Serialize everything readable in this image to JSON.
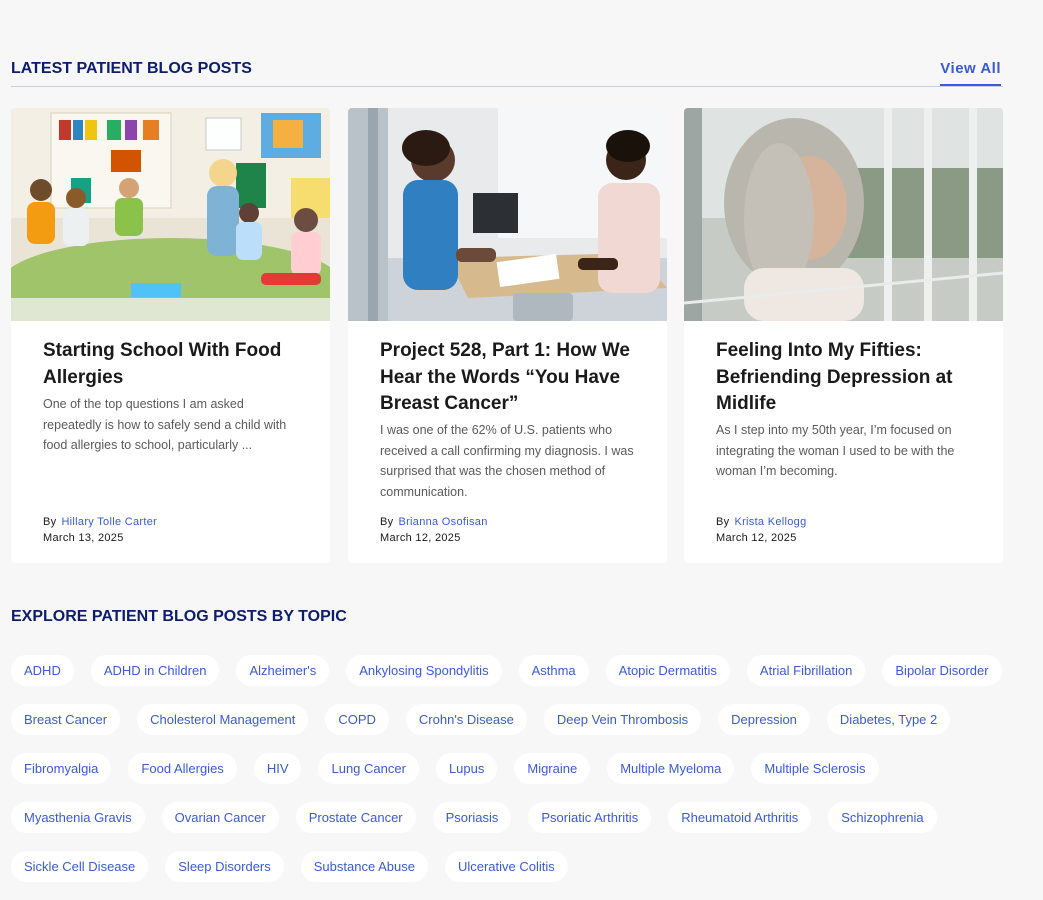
{
  "latest": {
    "title": "LATEST PATIENT BLOG POSTS",
    "view_all": "View All"
  },
  "posts": [
    {
      "title": "Starting School With Food Allergies",
      "excerpt": "One of the top questions I am asked repeatedly is how to safely send a child with food allergies to school, particularly ...",
      "by": "By",
      "author": "Hillary Tolle Carter",
      "date": "March 13, 2025"
    },
    {
      "title": "Project 528, Part 1: How We Hear the Words “You Have Breast Cancer”",
      "excerpt": "I was one of the 62% of U.S. patients who received a call confirming my diagnosis. I was surprised that was the chosen method of communication.",
      "by": "By",
      "author": "Brianna Osofisan",
      "date": "March 12, 2025"
    },
    {
      "title": "Feeling Into My Fifties: Befriending Depression at Midlife",
      "excerpt": "As I step into my 50th year, I’m focused on integrating the woman I used to be with the woman I’m becoming.",
      "by": "By",
      "author": "Krista Kellogg",
      "date": "March 12, 2025"
    }
  ],
  "topics": {
    "title": "EXPLORE PATIENT BLOG POSTS BY TOPIC",
    "rows": [
      [
        "ADHD",
        "ADHD in Children",
        "Alzheimer's",
        "Ankylosing Spondylitis",
        "Asthma",
        "Atopic Dermatitis",
        "Atrial Fibrillation",
        "Bipolar Disorder"
      ],
      [
        "Breast Cancer",
        "Cholesterol Management",
        "COPD",
        "Crohn's Disease",
        "Deep Vein Thrombosis",
        "Depression",
        "Diabetes, Type 2"
      ],
      [
        "Fibromyalgia",
        "Food Allergies",
        "HIV",
        "Lung Cancer",
        "Lupus",
        "Migraine",
        "Multiple Myeloma",
        "Multiple Sclerosis"
      ],
      [
        "Myasthenia Gravis",
        "Ovarian Cancer",
        "Prostate Cancer",
        "Psoriasis",
        "Psoriatic Arthritis",
        "Rheumatoid Arthritis",
        "Schizophrenia"
      ],
      [
        "Sickle Cell Disease",
        "Sleep Disorders",
        "Substance Abuse",
        "Ulcerative Colitis"
      ]
    ]
  },
  "colors": {
    "heading": "#0c1d6e",
    "link": "#3a5ad6",
    "background": "#f7f7f8"
  }
}
